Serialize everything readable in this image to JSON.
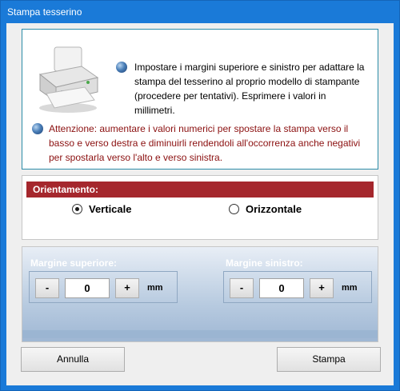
{
  "window": {
    "title": "Stampa tesserino",
    "accent_color": "#1a7ad8"
  },
  "info": {
    "icon": "printer-icon",
    "text1": "Impostare i margini superiore e sinistro per adattare la stampa del tesserino al proprio modello di stampante (procedere per tentativi). Esprimere i valori in millimetri.",
    "text2": "Attenzione: aumentare i valori numerici per spostare la stampa verso il basso e verso destra e diminuirli rendendoli all'occorrenza anche negativi per spostarla verso l'alto e verso sinistra.",
    "warning_color": "#8b1010"
  },
  "orientation": {
    "header": "Orientamento:",
    "header_color": "#a5272d",
    "options": [
      {
        "label": "Verticale",
        "selected": true
      },
      {
        "label": "Orizzontale",
        "selected": false
      }
    ]
  },
  "margins": {
    "top": {
      "label": "Margine superiore:",
      "minus": "-",
      "value": "0",
      "plus": "+",
      "unit": "mm"
    },
    "left": {
      "label": "Margine sinistro:",
      "minus": "-",
      "value": "0",
      "plus": "+",
      "unit": "mm"
    }
  },
  "buttons": {
    "cancel": "Annulla",
    "print": "Stampa"
  }
}
